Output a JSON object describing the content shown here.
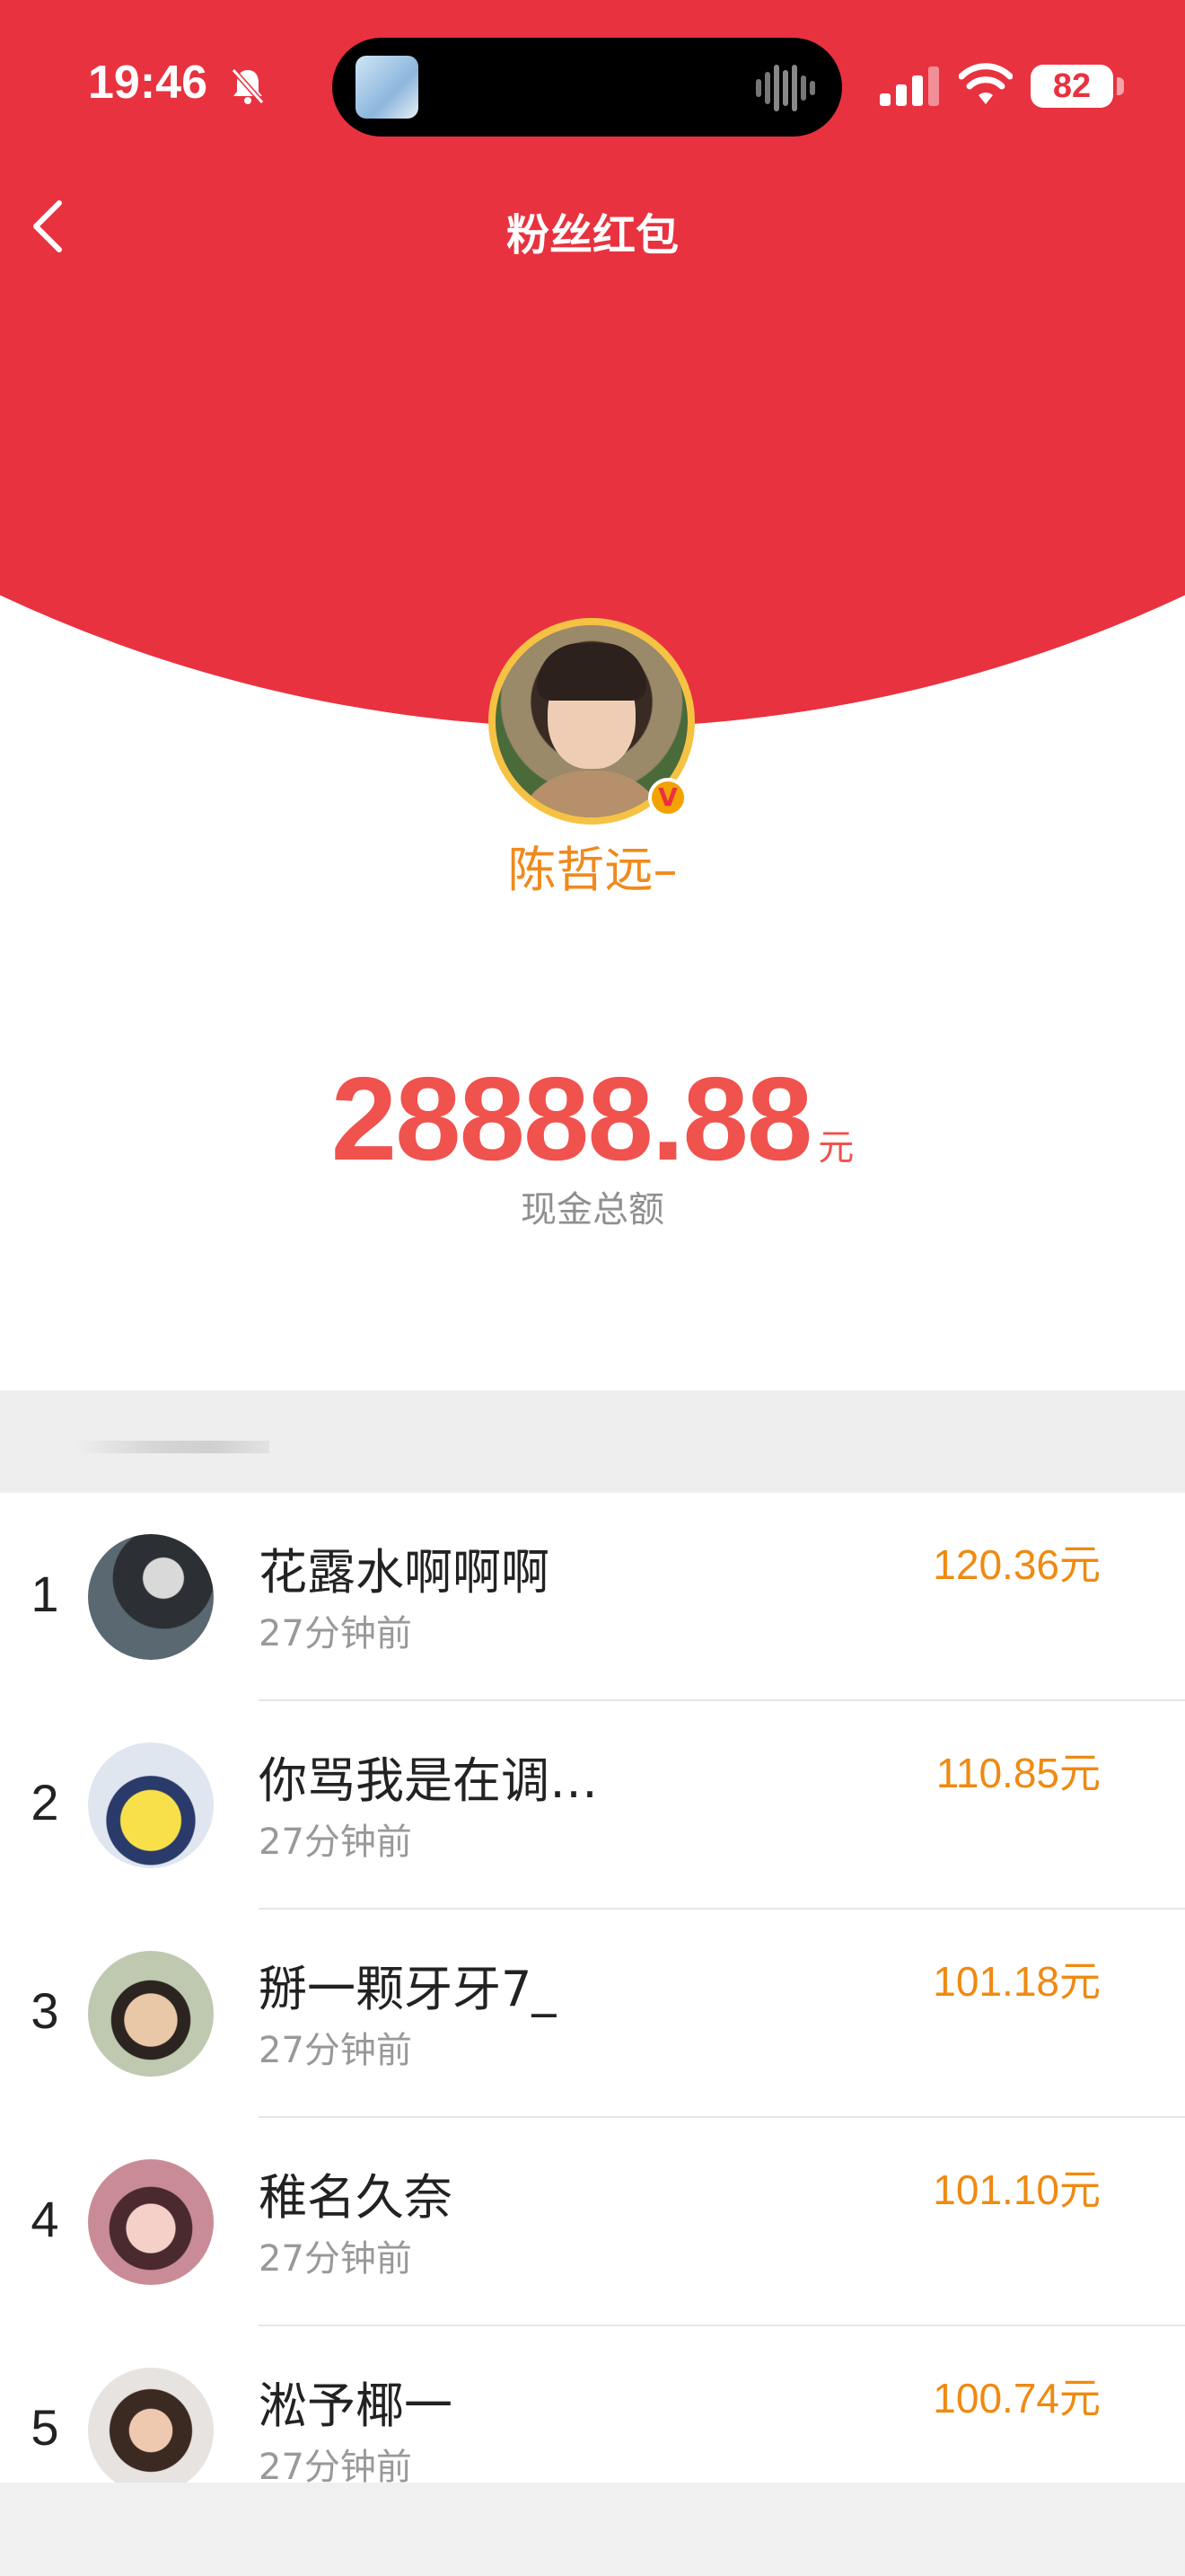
{
  "status_bar": {
    "time": "19:46",
    "battery": "82"
  },
  "header": {
    "title": "粉丝红包"
  },
  "profile": {
    "name": "陈哲远–",
    "badge": "V"
  },
  "total": {
    "amount": "28888.88",
    "unit": "元",
    "label": "现金总额"
  },
  "list": [
    {
      "rank": "1",
      "name": "花露水啊啊啊",
      "time": "27分钟前",
      "amount": "120.36元"
    },
    {
      "rank": "2",
      "name": "你骂我是在调…",
      "time": "27分钟前",
      "amount": "110.85元"
    },
    {
      "rank": "3",
      "name": "掰一颗牙牙7_",
      "time": "27分钟前",
      "amount": "101.18元"
    },
    {
      "rank": "4",
      "name": "稚名久奈",
      "time": "27分钟前",
      "amount": "101.10元"
    },
    {
      "rank": "5",
      "name": "淞予椰一",
      "time": "27分钟前",
      "amount": "100.74元"
    }
  ],
  "colors": {
    "brand_red": "#e8323f",
    "accent_orange": "#ef8a12",
    "amount_red": "#f0524d"
  }
}
